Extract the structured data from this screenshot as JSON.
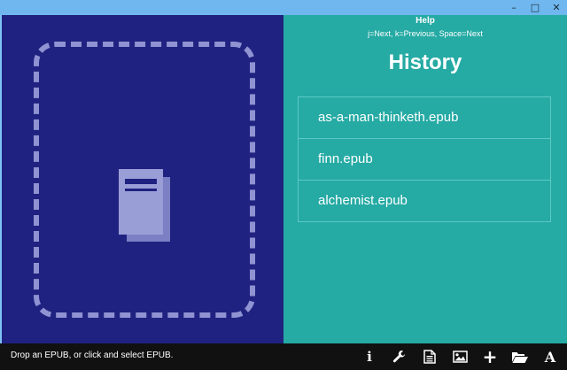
{
  "window": {
    "controls": {
      "minimize": "–",
      "maximize": "□",
      "close": "✕"
    }
  },
  "left_panel": {
    "icon": "book-icon",
    "colors": {
      "background": "#1f2280",
      "dash": "#8f93d2"
    }
  },
  "help": {
    "title": "Help",
    "keys": "j=Next, k=Previous, Space=Next"
  },
  "history": {
    "title": "History",
    "items": [
      {
        "label": "as-a-man-thinketh.epub"
      },
      {
        "label": "finn.epub"
      },
      {
        "label": "alchemist.epub"
      }
    ]
  },
  "status": {
    "text": "Drop an EPUB, or click and select EPUB."
  },
  "toolbar": {
    "info_label": "i",
    "add_label": "+",
    "font_label": "A",
    "icons": [
      "info-icon",
      "wrench-icon",
      "document-icon",
      "image-icon",
      "plus-icon",
      "folder-open-icon",
      "font-icon"
    ]
  },
  "colors": {
    "right_panel": "#25aaa4",
    "status_bar": "#111111",
    "titlebar": "#6fb7ee"
  }
}
